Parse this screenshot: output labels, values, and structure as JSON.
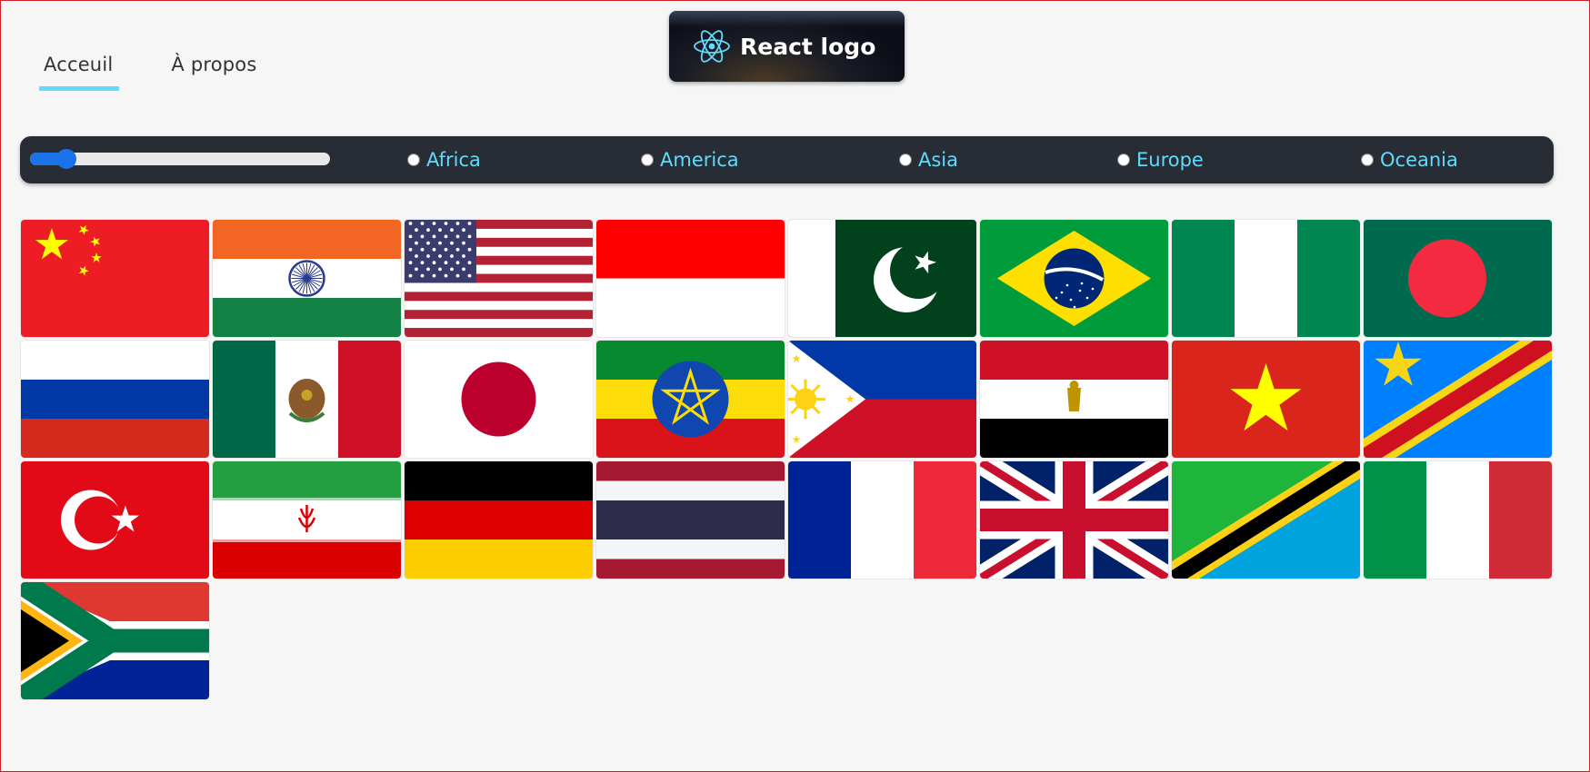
{
  "nav": {
    "items": [
      {
        "label": "Acceuil",
        "active": true
      },
      {
        "label": "À propos",
        "active": false
      }
    ]
  },
  "logo": {
    "text": "React logo",
    "icon": "react-atom-icon"
  },
  "filter": {
    "slider_value": 0.12,
    "regions": [
      "Africa",
      "America",
      "Asia",
      "Europe",
      "Oceania"
    ],
    "selected": null
  },
  "flags": [
    "china",
    "india",
    "united-states",
    "indonesia",
    "pakistan",
    "brazil",
    "nigeria",
    "bangladesh",
    "russia",
    "mexico",
    "japan",
    "ethiopia",
    "philippines",
    "egypt",
    "vietnam",
    "dr-congo",
    "turkey",
    "iran",
    "germany",
    "thailand",
    "france",
    "united-kingdom",
    "tanzania",
    "italy",
    "south-africa"
  ],
  "colors": {
    "accent": "#61dafb",
    "bar": "#282c34",
    "slider": "#1a73e8"
  }
}
